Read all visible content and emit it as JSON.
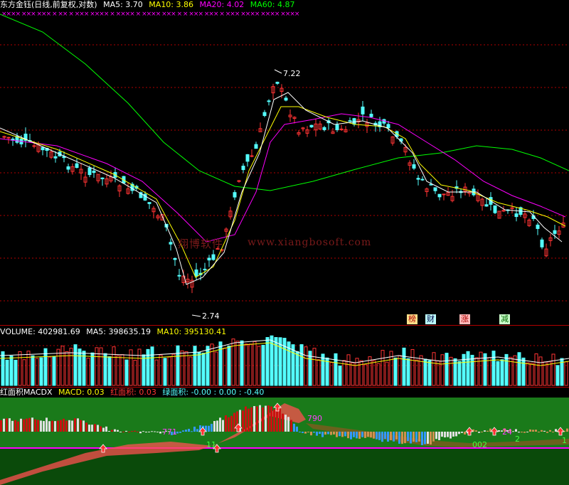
{
  "price_header": {
    "title": "东方金钰(日线,前复权,对数)",
    "ma5_label": "MA5: 3.70",
    "ma10_label": "MA10: 3.86",
    "ma20_label": "MA20: 4.02",
    "ma60_label": "MA60: 4.87",
    "marks": "××××  ×××  ×××  ×  ××  ×  ×××  ××××  ×  ××××  ×  ××××  ×××  ×  ×  ×××  ×××  ×  ×××  ××××  ××××  ××××"
  },
  "price_annotations": {
    "high": "7.22",
    "low": "2.74"
  },
  "badges": {
    "b1": "榜",
    "b2": "财",
    "b3": "涨",
    "b4": "减"
  },
  "watermark": {
    "cn": "翔博软件",
    "url": "www.xiangbosoft.com"
  },
  "volume_header": {
    "title": "VOLUME: 402981.69",
    "ma5_label": "MA5: 398635.19",
    "ma10_label": "MA10: 395130.41"
  },
  "macd_header": {
    "title": "红面积MACDX",
    "macd_label": "MACD: 0.03",
    "red_label": "红面积: 0.03",
    "green_label": "绿面积: -0.00 : 0.00 : -0.40"
  },
  "macd_labels": {
    "l1": "771",
    "l2": "11",
    "l3": "790",
    "l4": "002",
    "l5": "2",
    "l6": "1",
    "l7": "24"
  },
  "colors": {
    "up": "#ff3333",
    "down": "#54ffff",
    "ma5": "#ffffff",
    "ma10": "#ffff00",
    "ma20": "#ff00ff",
    "ma60": "#00ff00",
    "grid": "#b00000",
    "marks": "#ff00ff",
    "macd_bg": "#1f7a1f"
  },
  "chart_data": [
    {
      "type": "candlestick",
      "title": "东方金钰(日线,前复权,对数)",
      "scale": "log",
      "series": [
        {
          "name": "MA5",
          "latest": 3.7
        },
        {
          "name": "MA10",
          "latest": 3.86
        },
        {
          "name": "MA20",
          "latest": 4.02
        },
        {
          "name": "MA60",
          "latest": 4.87
        }
      ],
      "annotations": [
        {
          "label": "7.22"
        },
        {
          "label": "2.74"
        }
      ]
    },
    {
      "type": "bar",
      "title": "VOLUME",
      "series": [
        {
          "name": "VOLUME",
          "latest": 402981.69
        },
        {
          "name": "MA5",
          "latest": 398635.19
        },
        {
          "name": "MA10",
          "latest": 395130.41
        }
      ]
    },
    {
      "type": "bar",
      "title": "红面积MACDX",
      "series": [
        {
          "name": "MACD",
          "latest": 0.03
        },
        {
          "name": "红面积",
          "latest": 0.03
        }
      ]
    }
  ]
}
